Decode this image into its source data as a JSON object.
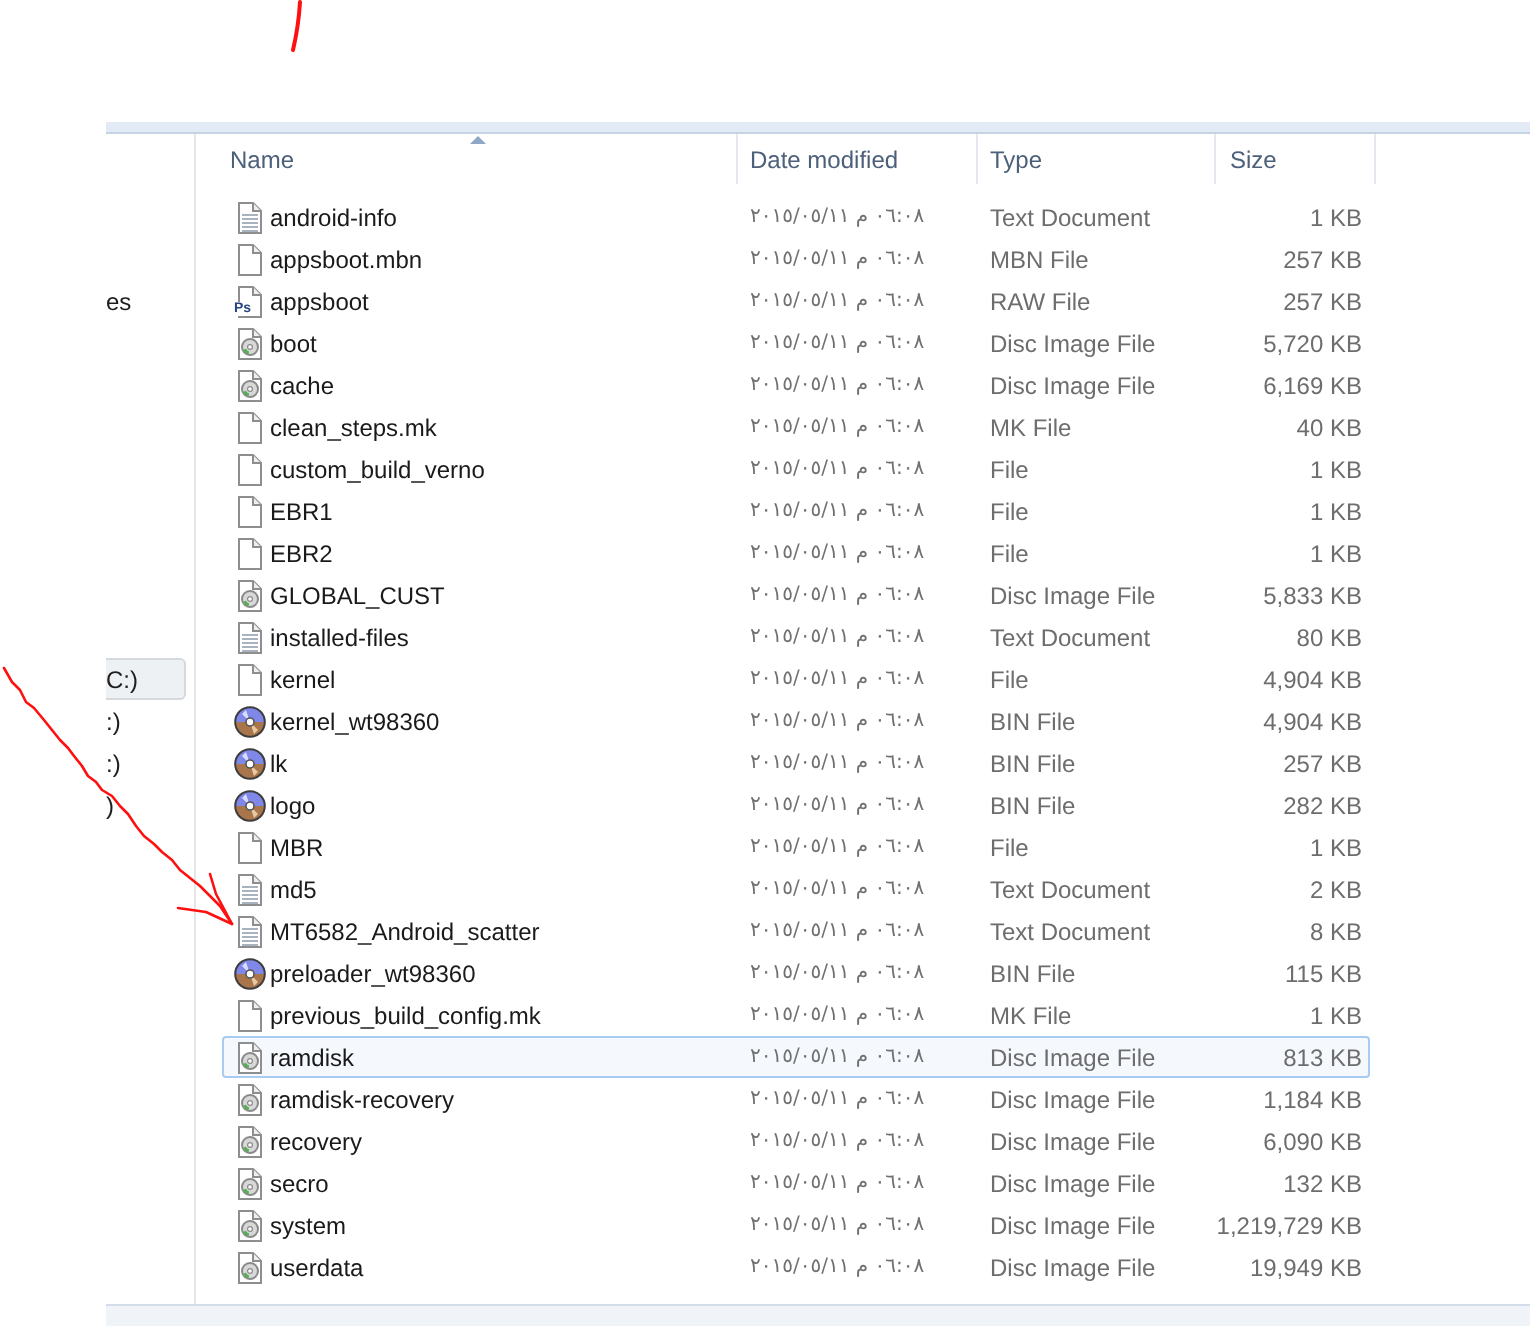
{
  "sidebar": {
    "sections": [
      {
        "items": [
          {
            "label": "es",
            "selected": false
          }
        ]
      },
      {
        "items": [
          {
            "label": "C:)",
            "selected": true
          },
          {
            "label": ":)",
            "selected": false
          },
          {
            "label": ":)",
            "selected": false
          },
          {
            "label": ")",
            "selected": false
          }
        ]
      }
    ]
  },
  "table": {
    "columns": [
      {
        "label": "Name",
        "sorted": true
      },
      {
        "label": "Date modified",
        "sorted": false
      },
      {
        "label": "Type",
        "sorted": false
      },
      {
        "label": "Size",
        "sorted": false
      }
    ],
    "rows": [
      {
        "name": "android-info",
        "kind": "text",
        "date": "٢٠١٥/٠٥/١١ م ٠٦:٠٨",
        "type": "Text Document",
        "size": "1 KB",
        "selected": false
      },
      {
        "name": "appsboot.mbn",
        "kind": "blank",
        "date": "٢٠١٥/٠٥/١١ م ٠٦:٠٨",
        "type": "MBN File",
        "size": "257 KB",
        "selected": false
      },
      {
        "name": "appsboot",
        "kind": "labeled",
        "badge": "Ps",
        "date": "٢٠١٥/٠٥/١١ م ٠٦:٠٨",
        "type": "RAW File",
        "size": "257 KB",
        "selected": false
      },
      {
        "name": "boot",
        "kind": "disc-image",
        "date": "٢٠١٥/٠٥/١١ م ٠٦:٠٨",
        "type": "Disc Image File",
        "size": "5,720 KB",
        "selected": false
      },
      {
        "name": "cache",
        "kind": "disc-image",
        "date": "٢٠١٥/٠٥/١١ م ٠٦:٠٨",
        "type": "Disc Image File",
        "size": "6,169 KB",
        "selected": false
      },
      {
        "name": "clean_steps.mk",
        "kind": "blank",
        "date": "٢٠١٥/٠٥/١١ م ٠٦:٠٨",
        "type": "MK File",
        "size": "40 KB",
        "selected": false
      },
      {
        "name": "custom_build_verno",
        "kind": "blank",
        "date": "٢٠١٥/٠٥/١١ م ٠٦:٠٨",
        "type": "File",
        "size": "1 KB",
        "selected": false
      },
      {
        "name": "EBR1",
        "kind": "blank",
        "date": "٢٠١٥/٠٥/١١ م ٠٦:٠٨",
        "type": "File",
        "size": "1 KB",
        "selected": false
      },
      {
        "name": "EBR2",
        "kind": "blank",
        "date": "٢٠١٥/٠٥/١١ م ٠٦:٠٨",
        "type": "File",
        "size": "1 KB",
        "selected": false
      },
      {
        "name": "GLOBAL_CUST",
        "kind": "disc-image",
        "date": "٢٠١٥/٠٥/١١ م ٠٦:٠٨",
        "type": "Disc Image File",
        "size": "5,833 KB",
        "selected": false
      },
      {
        "name": "installed-files",
        "kind": "text",
        "date": "٢٠١٥/٠٥/١١ م ٠٦:٠٨",
        "type": "Text Document",
        "size": "80 KB",
        "selected": false
      },
      {
        "name": "kernel",
        "kind": "blank",
        "date": "٢٠١٥/٠٥/١١ م ٠٦:٠٨",
        "type": "File",
        "size": "4,904 KB",
        "selected": false
      },
      {
        "name": "kernel_wt98360",
        "kind": "disc",
        "date": "٢٠١٥/٠٥/١١ م ٠٦:٠٨",
        "type": "BIN File",
        "size": "4,904 KB",
        "selected": false
      },
      {
        "name": "lk",
        "kind": "disc",
        "date": "٢٠١٥/٠٥/١١ م ٠٦:٠٨",
        "type": "BIN File",
        "size": "257 KB",
        "selected": false
      },
      {
        "name": "logo",
        "kind": "disc",
        "date": "٢٠١٥/٠٥/١١ م ٠٦:٠٨",
        "type": "BIN File",
        "size": "282 KB",
        "selected": false
      },
      {
        "name": "MBR",
        "kind": "blank",
        "date": "٢٠١٥/٠٥/١١ م ٠٦:٠٨",
        "type": "File",
        "size": "1 KB",
        "selected": false
      },
      {
        "name": "md5",
        "kind": "text",
        "date": "٢٠١٥/٠٥/١١ م ٠٦:٠٨",
        "type": "Text Document",
        "size": "2 KB",
        "selected": false
      },
      {
        "name": "MT6582_Android_scatter",
        "kind": "text",
        "date": "٢٠١٥/٠٥/١١ م ٠٦:٠٨",
        "type": "Text Document",
        "size": "8 KB",
        "selected": false
      },
      {
        "name": "preloader_wt98360",
        "kind": "disc",
        "date": "٢٠١٥/٠٥/١١ م ٠٦:٠٨",
        "type": "BIN File",
        "size": "115 KB",
        "selected": false
      },
      {
        "name": "previous_build_config.mk",
        "kind": "blank",
        "date": "٢٠١٥/٠٥/١١ م ٠٦:٠٨",
        "type": "MK File",
        "size": "1 KB",
        "selected": false
      },
      {
        "name": "ramdisk",
        "kind": "disc-image",
        "date": "٢٠١٥/٠٥/١١ م ٠٦:٠٨",
        "type": "Disc Image File",
        "size": "813 KB",
        "selected": true
      },
      {
        "name": "ramdisk-recovery",
        "kind": "disc-image",
        "date": "٢٠١٥/٠٥/١١ م ٠٦:٠٨",
        "type": "Disc Image File",
        "size": "1,184 KB",
        "selected": false
      },
      {
        "name": "recovery",
        "kind": "disc-image",
        "date": "٢٠١٥/٠٥/١١ م ٠٦:٠٨",
        "type": "Disc Image File",
        "size": "6,090 KB",
        "selected": false
      },
      {
        "name": "secro",
        "kind": "disc-image",
        "date": "٢٠١٥/٠٥/١١ م ٠٦:٠٨",
        "type": "Disc Image File",
        "size": "132 KB",
        "selected": false
      },
      {
        "name": "system",
        "kind": "disc-image",
        "date": "٢٠١٥/٠٥/١١ م ٠٦:٠٨",
        "type": "Disc Image File",
        "size": "1,219,729 KB",
        "selected": false
      },
      {
        "name": "userdata",
        "kind": "disc-image",
        "date": "٢٠١٥/٠٥/١١ م ٠٦:٠٨",
        "type": "Disc Image File",
        "size": "19,949 KB",
        "selected": false
      }
    ]
  }
}
